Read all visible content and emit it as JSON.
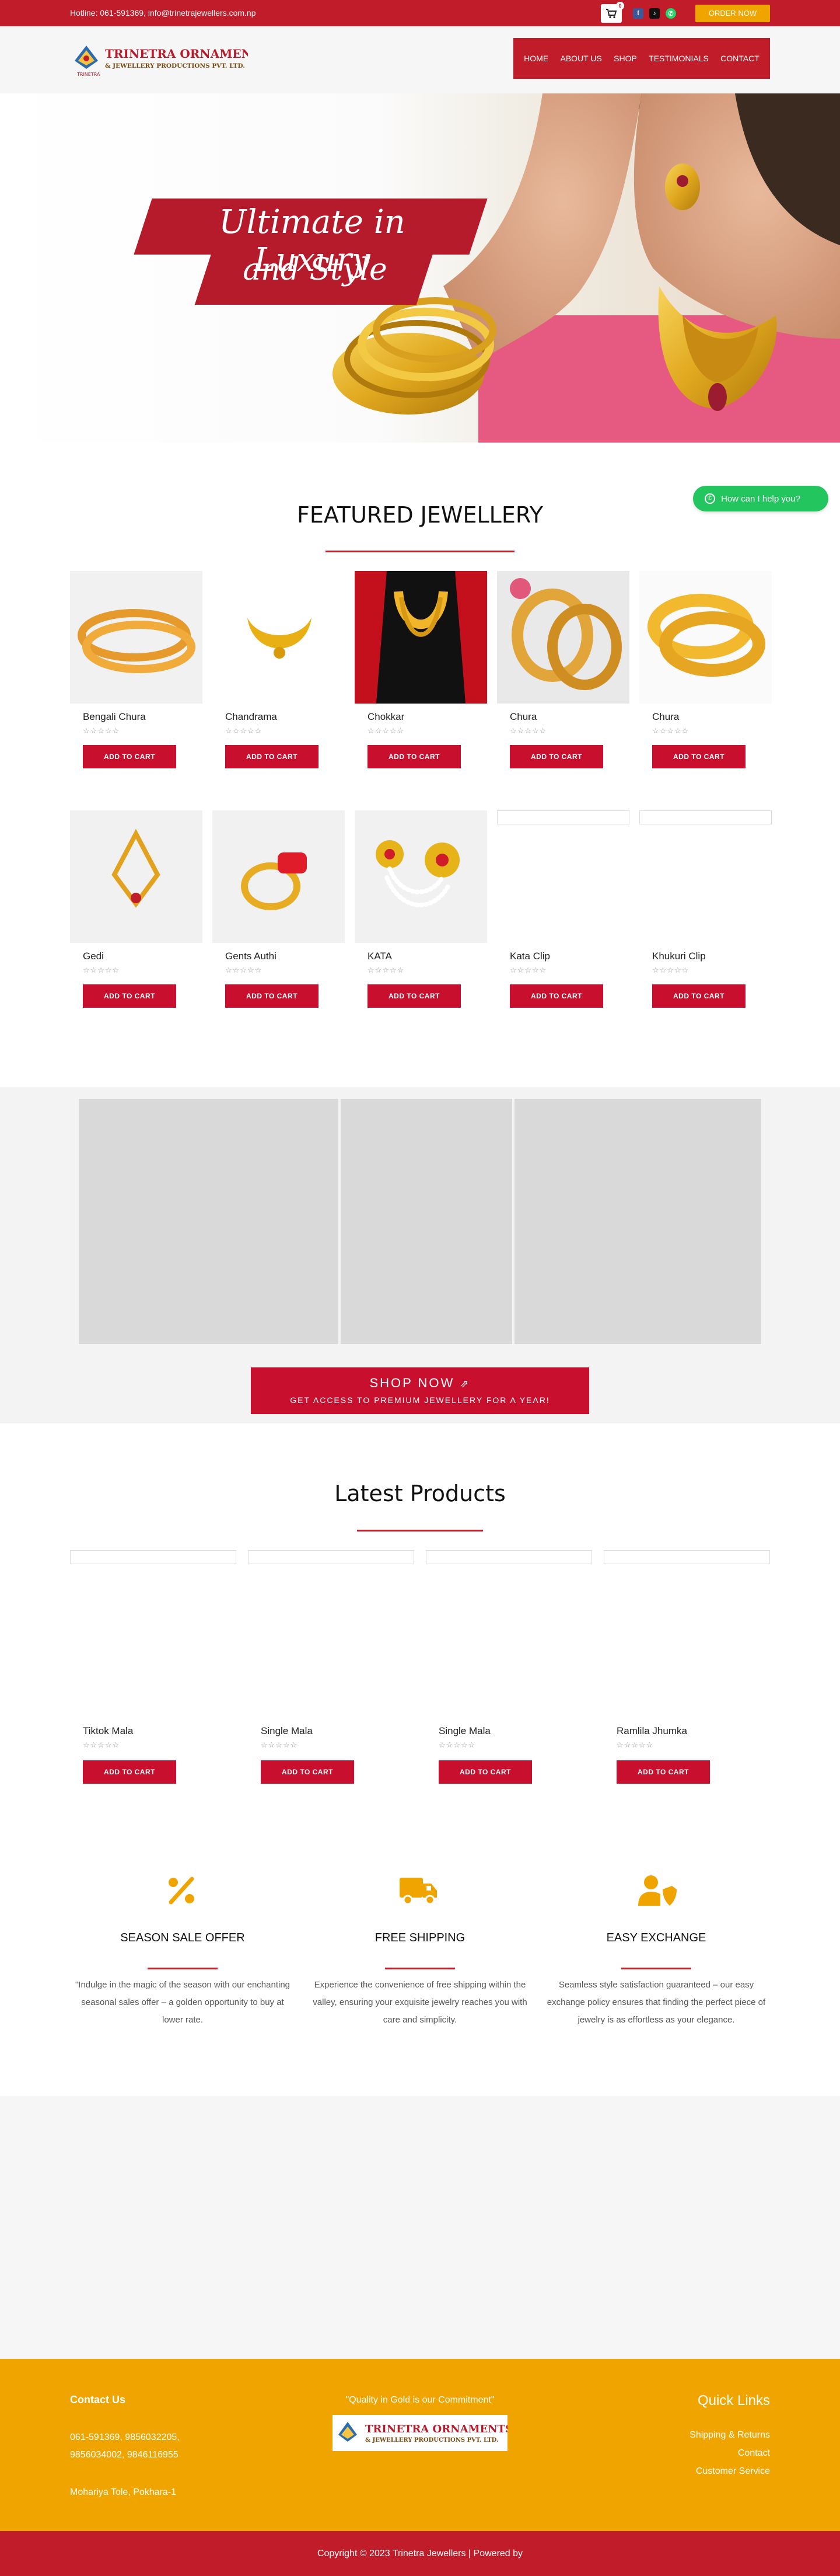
{
  "topbar": {
    "hotline": "Hotline: 061-591369, info@trinetrajewellers.com.np",
    "cart_count": "0",
    "order_label": "ORDER NOW",
    "colors": {
      "bar": "#c01c2a",
      "order": "#f0a400"
    }
  },
  "header": {
    "logo_title": "TRINETRA ORNAMENTS",
    "logo_subtitle": "& JEWELLERY PRODUCTIONS PVT. LTD.",
    "logo_caption": "TRINETRA",
    "nav": [
      "HOME",
      "ABOUT US",
      "SHOP",
      "TESTIMONIALS",
      "CONTACT"
    ]
  },
  "hero": {
    "line1": "Ultimate in Luxury",
    "line2": "and Style"
  },
  "whatsapp": {
    "label": "How can I help you?"
  },
  "featured": {
    "title": "FEATURED JEWELLERY",
    "cart_label": "ADD TO CART",
    "stars": "☆☆☆☆☆",
    "products": [
      {
        "name": "Bengali Chura"
      },
      {
        "name": "Chandrama"
      },
      {
        "name": "Chokkar"
      },
      {
        "name": "Chura"
      },
      {
        "name": "Chura"
      },
      {
        "name": "Gedi"
      },
      {
        "name": "Gents Authi"
      },
      {
        "name": "KATA"
      },
      {
        "name": "Kata Clip"
      },
      {
        "name": "Khukuri Clip"
      }
    ]
  },
  "promo": {
    "shop_now": "SHOP NOW",
    "sub": "GET ACCESS TO PREMIUM JEWELLERY FOR A YEAR!"
  },
  "latest": {
    "title": "Latest Products",
    "cart_label": "ADD TO CART",
    "stars": "☆☆☆☆☆",
    "products": [
      {
        "name": "Tiktok Mala"
      },
      {
        "name": "Single Mala"
      },
      {
        "name": "Single Mala"
      },
      {
        "name": "Ramlila Jhumka"
      }
    ]
  },
  "features": [
    {
      "icon": "percent-icon",
      "title": "SEASON SALE OFFER",
      "text": "\"Indulge in the magic of the season with our enchanting seasonal sales offer – a golden opportunity to buy at lower rate."
    },
    {
      "icon": "truck-icon",
      "title": "FREE SHIPPING",
      "text": "Experience the convenience of free shipping within the valley, ensuring your exquisite jewelry reaches you with care and simplicity."
    },
    {
      "icon": "user-shield-icon",
      "title": "EASY EXCHANGE",
      "text": "Seamless style satisfaction guaranteed – our easy exchange policy ensures that finding the perfect piece of jewelry is as effortless as your elegance."
    }
  ],
  "footer": {
    "contact_title": "Contact Us",
    "phone1": "061-591369, 9856032205,",
    "phone2": "9856034002, 9846116955",
    "address": "Mohariya Tole, Pokhara-1",
    "quote": "\"Quality in Gold is our Commitment\"",
    "links_title": "Quick Links",
    "links": [
      "Shipping & Returns",
      "Contact",
      "Customer Service"
    ],
    "copyright": "Copyright © 2023 Trinetra Jewellers | Powered by"
  }
}
